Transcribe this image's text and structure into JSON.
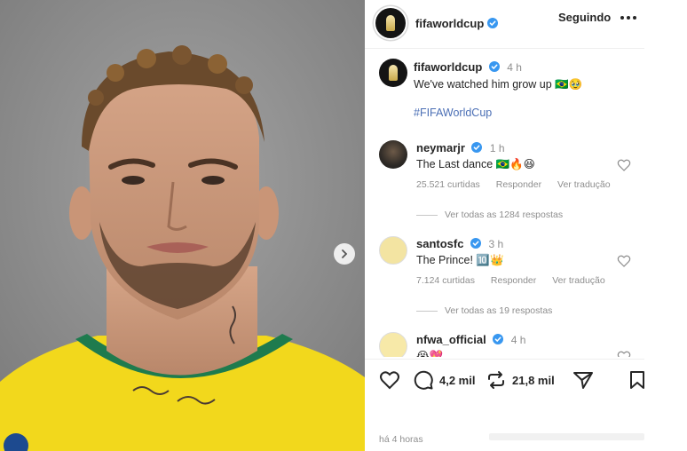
{
  "colors": {
    "verified": "#3897f0",
    "hashtag": "#4b6fb5",
    "muted": "#8e8e8e",
    "text": "#262626"
  },
  "photo": {
    "alt_icon": "carousel-next-icon"
  },
  "header": {
    "username": "fifaworldcup",
    "follow_label": "Seguindo",
    "more_icon": "more-options-icon"
  },
  "caption": {
    "username": "fifaworldcup",
    "time": "4 h",
    "text": "We've watched him grow up 🇧🇷🥹",
    "hashtag": "#FIFAWorldCup"
  },
  "comments": [
    {
      "username": "neymarjr",
      "time": "1 h",
      "text": "The Last dance 🇧🇷🔥😆",
      "likes": "25.521 curtidas",
      "reply": "Responder",
      "translate": "Ver tradução",
      "view_replies": "Ver todas as 1284 respostas"
    },
    {
      "username": "santosfc",
      "time": "3 h",
      "text": "The Prince! 🔟👑",
      "likes": "7.124 curtidas",
      "reply": "Responder",
      "translate": "Ver tradução",
      "view_replies": "Ver todas as 19 respostas"
    },
    {
      "username": "nfwa_official",
      "time": "4 h",
      "text": "😭💖"
    }
  ],
  "actions": {
    "comments_count": "4,2 mil",
    "reposts_count": "21,8 mil"
  },
  "posted": "há 4 horas"
}
